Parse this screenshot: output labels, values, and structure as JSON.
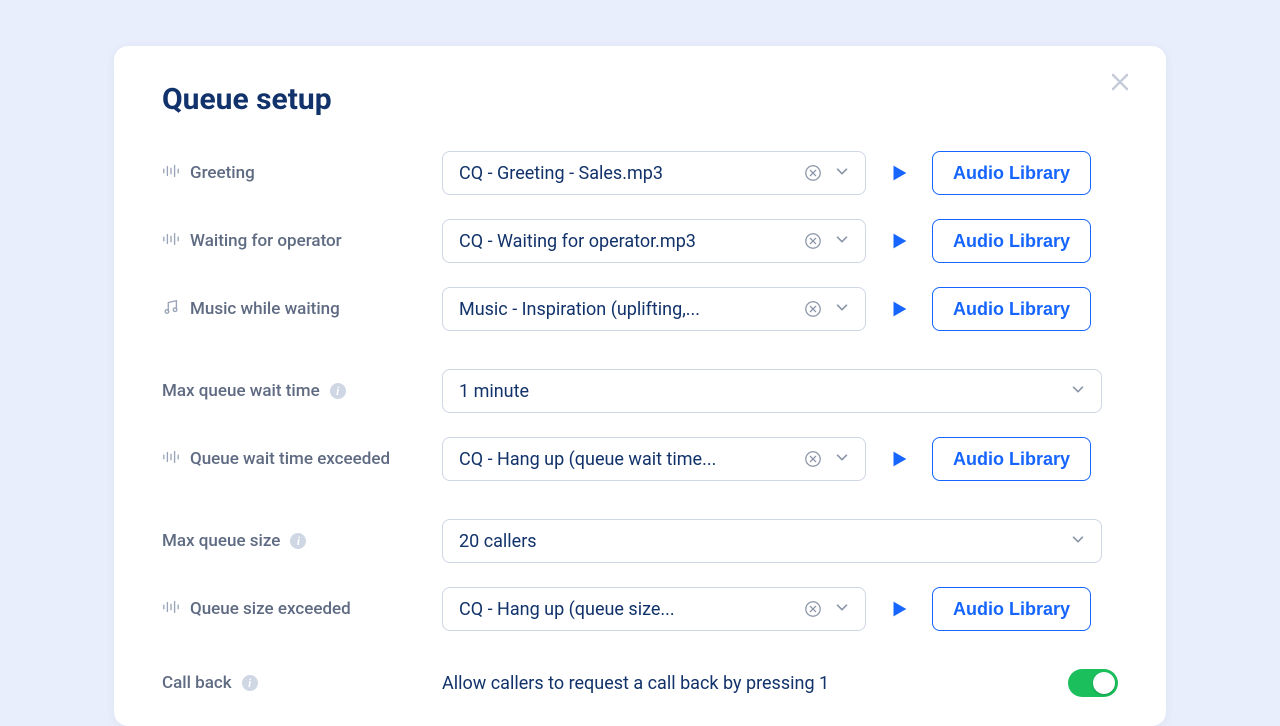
{
  "title": "Queue setup",
  "audioLibraryLabel": "Audio Library",
  "rows": {
    "greeting": {
      "label": "Greeting",
      "value": "CQ - Greeting - Sales.mp3"
    },
    "waiting": {
      "label": "Waiting for operator",
      "value": "CQ - Waiting for operator.mp3"
    },
    "music": {
      "label": "Music while waiting",
      "value": "Music - Inspiration (uplifting,..."
    },
    "maxWait": {
      "label": "Max queue wait time",
      "value": "1 minute"
    },
    "waitExceeded": {
      "label": "Queue wait time exceeded",
      "value": "CQ - Hang up (queue wait time..."
    },
    "maxSize": {
      "label": "Max queue size",
      "value": "20 callers"
    },
    "sizeExceeded": {
      "label": "Queue size exceeded",
      "value": "CQ - Hang up (queue size..."
    },
    "callback": {
      "label": "Call back",
      "desc": "Allow callers to request a call back by pressing 1"
    }
  }
}
